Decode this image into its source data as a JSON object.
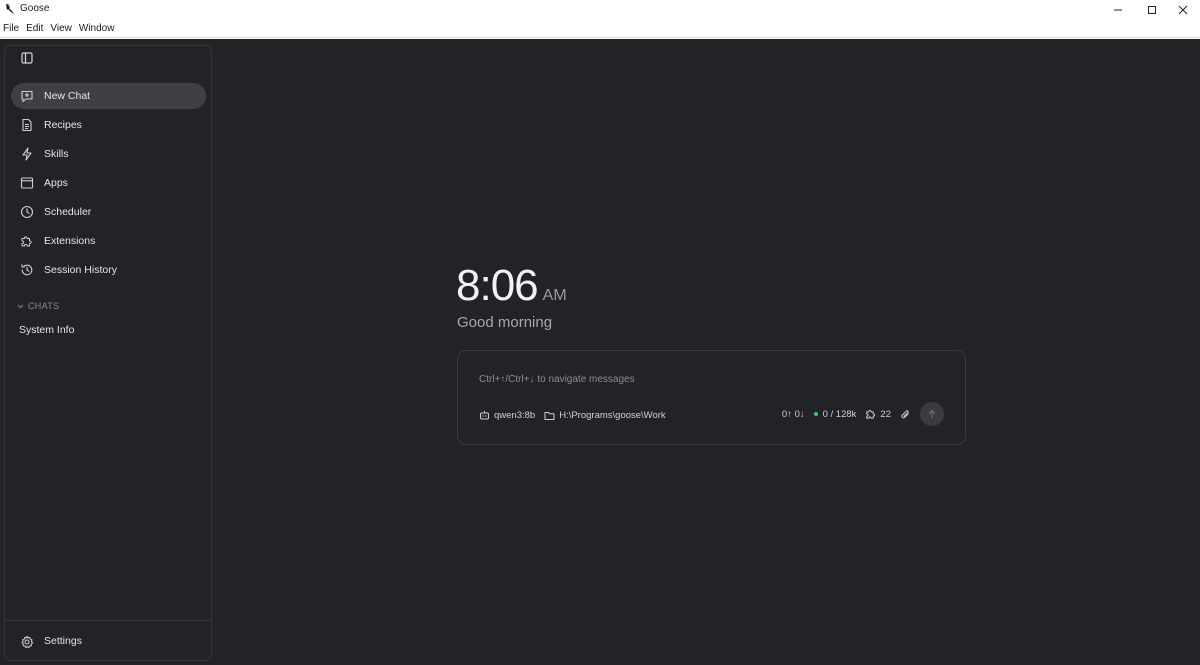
{
  "window": {
    "title": "Goose",
    "controls": [
      "minimize",
      "maximize",
      "close"
    ]
  },
  "menu": {
    "items": [
      "File",
      "Edit",
      "View",
      "Window"
    ]
  },
  "sidebar": {
    "nav": [
      {
        "label": "New Chat",
        "icon": "chat-plus-icon",
        "active": true
      },
      {
        "label": "Recipes",
        "icon": "document-icon"
      },
      {
        "label": "Skills",
        "icon": "lightning-icon"
      },
      {
        "label": "Apps",
        "icon": "app-window-icon"
      },
      {
        "label": "Scheduler",
        "icon": "clock-icon"
      },
      {
        "label": "Extensions",
        "icon": "puzzle-icon"
      },
      {
        "label": "Session History",
        "icon": "history-icon"
      }
    ],
    "chats_header": "CHATS",
    "chats": [
      {
        "label": "System Info"
      }
    ],
    "settings": {
      "label": "Settings",
      "icon": "gear-icon"
    }
  },
  "main": {
    "time": "8:06",
    "ampm": "AM",
    "greeting": "Good morning",
    "composer": {
      "placeholder": "Ctrl+↑/Ctrl+↓ to navigate messages",
      "model": "qwen3:8b",
      "directory": "H:\\Programs\\goose\\Work",
      "token_counts": "0↑ 0↓",
      "context_usage": "0 / 128k",
      "extensions_count": "22"
    }
  },
  "colors": {
    "background": "#222326",
    "active_nav": "#3f4044",
    "context_dot": "#2bd36a"
  }
}
